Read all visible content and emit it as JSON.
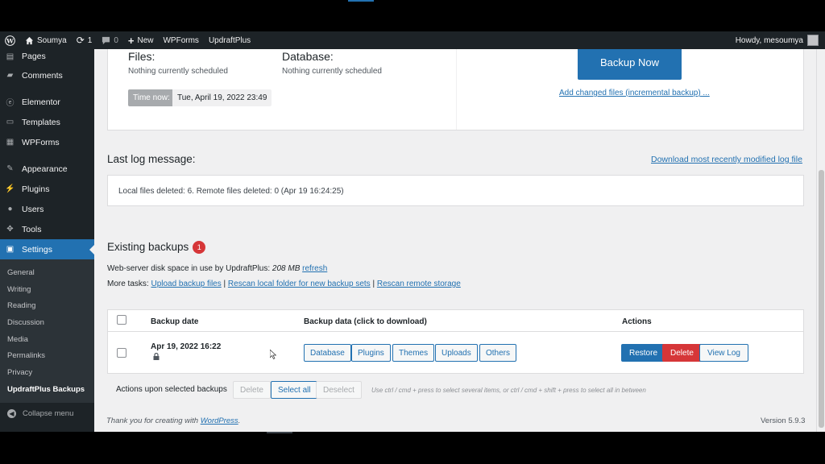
{
  "adminbar": {
    "site_name": "Soumya",
    "updates_count": "1",
    "comments_count": "0",
    "new_label": "New",
    "wpforms_label": "WPForms",
    "updraft_label": "UpdraftPlus",
    "howdy": "Howdy, mesoumya"
  },
  "sidebar": {
    "items": [
      {
        "label": "Pages",
        "icon": "pages-icon"
      },
      {
        "label": "Comments",
        "icon": "comments-icon"
      },
      {
        "label": "Elementor",
        "icon": "elementor-icon"
      },
      {
        "label": "Templates",
        "icon": "templates-icon"
      },
      {
        "label": "WPForms",
        "icon": "wpforms-icon"
      },
      {
        "label": "Appearance",
        "icon": "appearance-icon"
      },
      {
        "label": "Plugins",
        "icon": "plugins-icon"
      },
      {
        "label": "Users",
        "icon": "users-icon"
      },
      {
        "label": "Tools",
        "icon": "tools-icon"
      },
      {
        "label": "Settings",
        "icon": "settings-icon"
      }
    ],
    "submenu": [
      "General",
      "Writing",
      "Reading",
      "Discussion",
      "Media",
      "Permalinks",
      "Privacy",
      "UpdraftPlus Backups"
    ],
    "collapse_label": "Collapse menu"
  },
  "schedule": {
    "files_title": "Files:",
    "files_status": "Nothing currently scheduled",
    "database_title": "Database:",
    "database_status": "Nothing currently scheduled",
    "time_now_label": "Time now:",
    "time_now_value": "Tue, April 19, 2022 23:49",
    "backup_now_label": "Backup Now",
    "incremental_link": "Add changed files (incremental backup) ..."
  },
  "log": {
    "title": "Last log message:",
    "download_link": "Download most recently modified log file",
    "message": "Local files deleted: 6. Remote files deleted: 0 (Apr 19 16:24:25)"
  },
  "existing": {
    "title": "Existing backups",
    "count": "1",
    "disk_label": "Web-server disk space in use by UpdraftPlus:",
    "disk_value": "208 MB",
    "refresh_link": "refresh",
    "tasks_label": "More tasks:",
    "task_upload": "Upload backup files",
    "task_rescan_local": "Rescan local folder for new backup sets",
    "task_rescan_remote": "Rescan remote storage",
    "sep": "|"
  },
  "table": {
    "headers": {
      "date": "Backup date",
      "data": "Backup data (click to download)",
      "actions": "Actions"
    },
    "row": {
      "date": "Apr 19, 2022 16:22",
      "components": [
        "Database",
        "Plugins",
        "Themes",
        "Uploads",
        "Others"
      ],
      "restore": "Restore",
      "delete": "Delete",
      "view_log": "View Log"
    }
  },
  "bulk": {
    "label": "Actions upon selected backups",
    "delete": "Delete",
    "select_all": "Select all",
    "deselect": "Deselect",
    "hint": "Use ctrl / cmd + press to select several items, or ctrl / cmd + shift + press to select all in between"
  },
  "footer": {
    "thanks_prefix": "Thank you for creating with",
    "wordpress_link": "WordPress",
    "thanks_suffix": ".",
    "version": "Version 5.9.3"
  },
  "colors": {
    "accent": "#2271b1",
    "danger": "#d63638",
    "sidebar": "#1d2327"
  }
}
